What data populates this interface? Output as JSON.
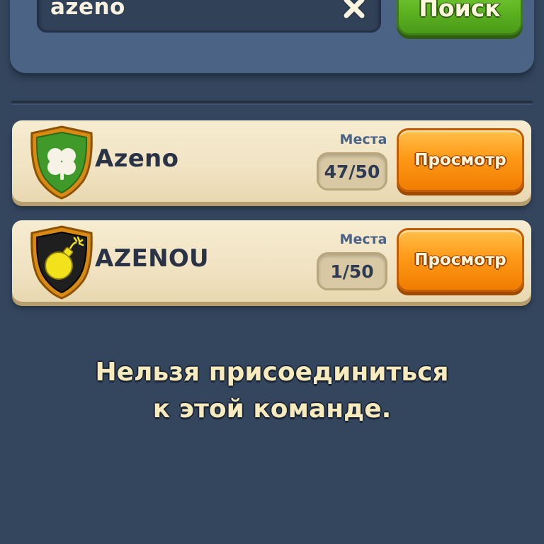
{
  "search": {
    "value": "azeno",
    "button_label": "Поиск"
  },
  "teams": [
    {
      "badge_icon": "clover-icon",
      "badge_color": "#3f9a2a",
      "name": "Azeno",
      "slots_label": "Места",
      "slots_value": "47/50",
      "view_label": "Просмотр"
    },
    {
      "badge_icon": "bomb-icon",
      "badge_color": "#1f1f1f",
      "name": "AZENOU",
      "slots_label": "Места",
      "slots_value": "1/50",
      "view_label": "Просмотр"
    }
  ],
  "message": {
    "line1": "Нельзя присоединиться",
    "line2": "к этой команде."
  },
  "colors": {
    "background": "#34465e",
    "search_button": "#5db321",
    "view_button": "#ff9a18",
    "row_background": "#f0e3c2"
  }
}
